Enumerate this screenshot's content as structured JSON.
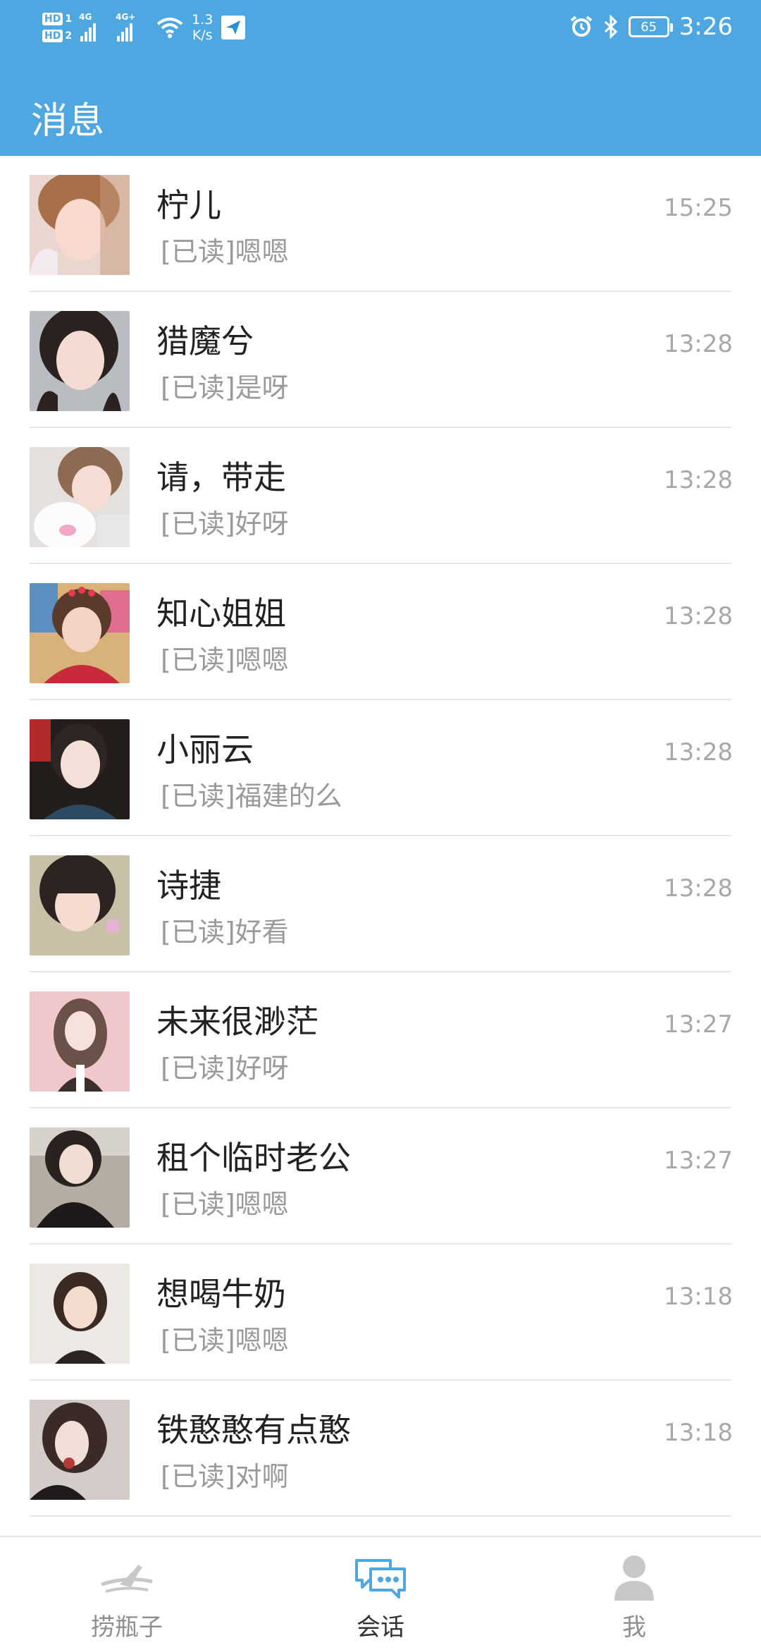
{
  "status_bar": {
    "sim1": "HD",
    "sim1_num": "1",
    "sim2": "HD",
    "sim2_num": "2",
    "net1": "4G",
    "net2": "4G+",
    "speed_value": "1.3",
    "speed_unit": "K/s",
    "battery": "65",
    "time": "3:26"
  },
  "header": {
    "title": "消息"
  },
  "conversations": [
    {
      "name": "柠儿",
      "preview": "[已读]嗯嗯",
      "time": "15:25"
    },
    {
      "name": "猎魔兮",
      "preview": "[已读]是呀",
      "time": "13:28"
    },
    {
      "name": "请，带走",
      "preview": "[已读]好呀",
      "time": "13:28"
    },
    {
      "name": "知心姐姐",
      "preview": "[已读]嗯嗯",
      "time": "13:28"
    },
    {
      "name": "小丽云",
      "preview": "[已读]福建的么",
      "time": "13:28"
    },
    {
      "name": "诗捷",
      "preview": "[已读]好看",
      "time": "13:28"
    },
    {
      "name": "未来很渺茫",
      "preview": "[已读]好呀",
      "time": "13:27"
    },
    {
      "name": "租个临时老公",
      "preview": "[已读]嗯嗯",
      "time": "13:27"
    },
    {
      "name": "想喝牛奶",
      "preview": "[已读]嗯嗯",
      "time": "13:18"
    },
    {
      "name": "铁憨憨有点憨",
      "preview": "[已读]对啊",
      "time": "13:18"
    }
  ],
  "tabbar": {
    "tabs": [
      {
        "label": "捞瓶子",
        "icon": "bottle-icon",
        "active": false
      },
      {
        "label": "会话",
        "icon": "chat-bubble-icon",
        "active": true
      },
      {
        "label": "我",
        "icon": "user-icon",
        "active": false
      }
    ]
  },
  "colors": {
    "header_bg": "#4ea7e0",
    "active_tab_icon": "#4ea7e0",
    "inactive_tab_icon": "#c8c8c8"
  }
}
